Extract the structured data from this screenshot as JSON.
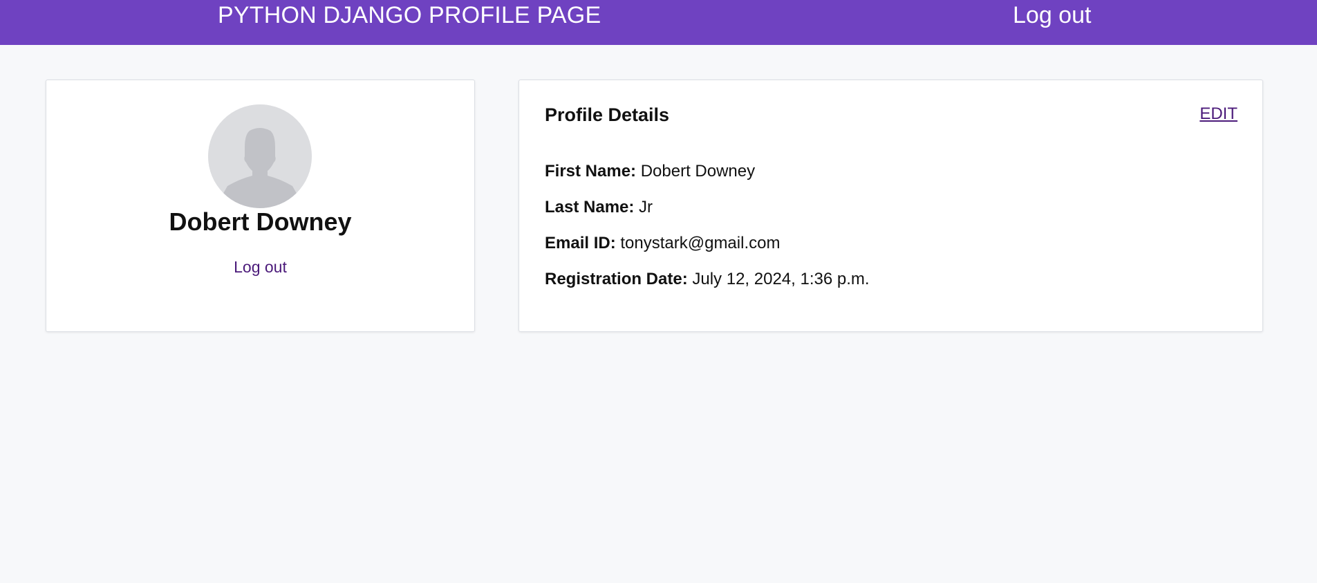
{
  "header": {
    "title": "PYTHON DJANGO PROFILE PAGE",
    "logout_label": "Log out",
    "background_color": "#6f42c1"
  },
  "profile_card": {
    "avatar_icon": "user-silhouette-icon",
    "name": "Dobert Downey",
    "logout_label": "Log out"
  },
  "details_card": {
    "heading": "Profile Details",
    "edit_label": "EDIT",
    "rows": [
      {
        "label": "First Name:",
        "value": "Dobert Downey"
      },
      {
        "label": "Last Name:",
        "value": "Jr"
      },
      {
        "label": "Email ID:",
        "value": "tonystark@gmail.com"
      },
      {
        "label": "Registration Date:",
        "value": "July 12, 2024, 1:36 p.m."
      }
    ]
  },
  "colors": {
    "accent": "#6f42c1",
    "link": "#4b1a7a",
    "page_background": "#f7f8fa"
  }
}
